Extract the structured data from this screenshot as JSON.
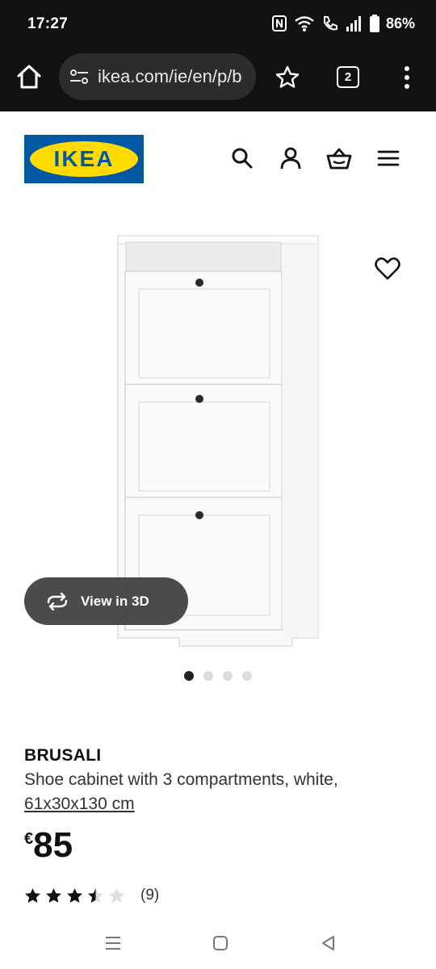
{
  "status_bar": {
    "time": "17:27",
    "battery": "86%",
    "icons": [
      "nfc-icon",
      "wifi-icon",
      "wifi-calling-icon",
      "signal-icon",
      "battery-icon"
    ]
  },
  "browser": {
    "url": "ikea.com/ie/en/p/b",
    "tab_count": "2",
    "icons": [
      "home-icon",
      "site-settings-icon",
      "bookmark-star-icon",
      "tabs-icon",
      "more-vert-icon"
    ]
  },
  "site_header": {
    "logo_text": "IKEA",
    "logo_colors": {
      "blue": "#0058a3",
      "yellow": "#ffdb00"
    },
    "icons": [
      "search-icon",
      "account-icon",
      "basket-icon",
      "hamburger-menu-icon"
    ]
  },
  "gallery": {
    "view_3d_label": "View in 3D",
    "image_count": 4,
    "active_index": 0
  },
  "product": {
    "name": "BRUSALI",
    "description": "Shoe cabinet with 3 compartments, white,",
    "size": "61x30x130 cm",
    "currency": "€",
    "price": "85",
    "rating_value": 3.5,
    "rating_max": 5,
    "review_count": "(9)"
  },
  "android_nav": {
    "icons": [
      "recents-icon",
      "home-icon",
      "back-icon"
    ]
  }
}
